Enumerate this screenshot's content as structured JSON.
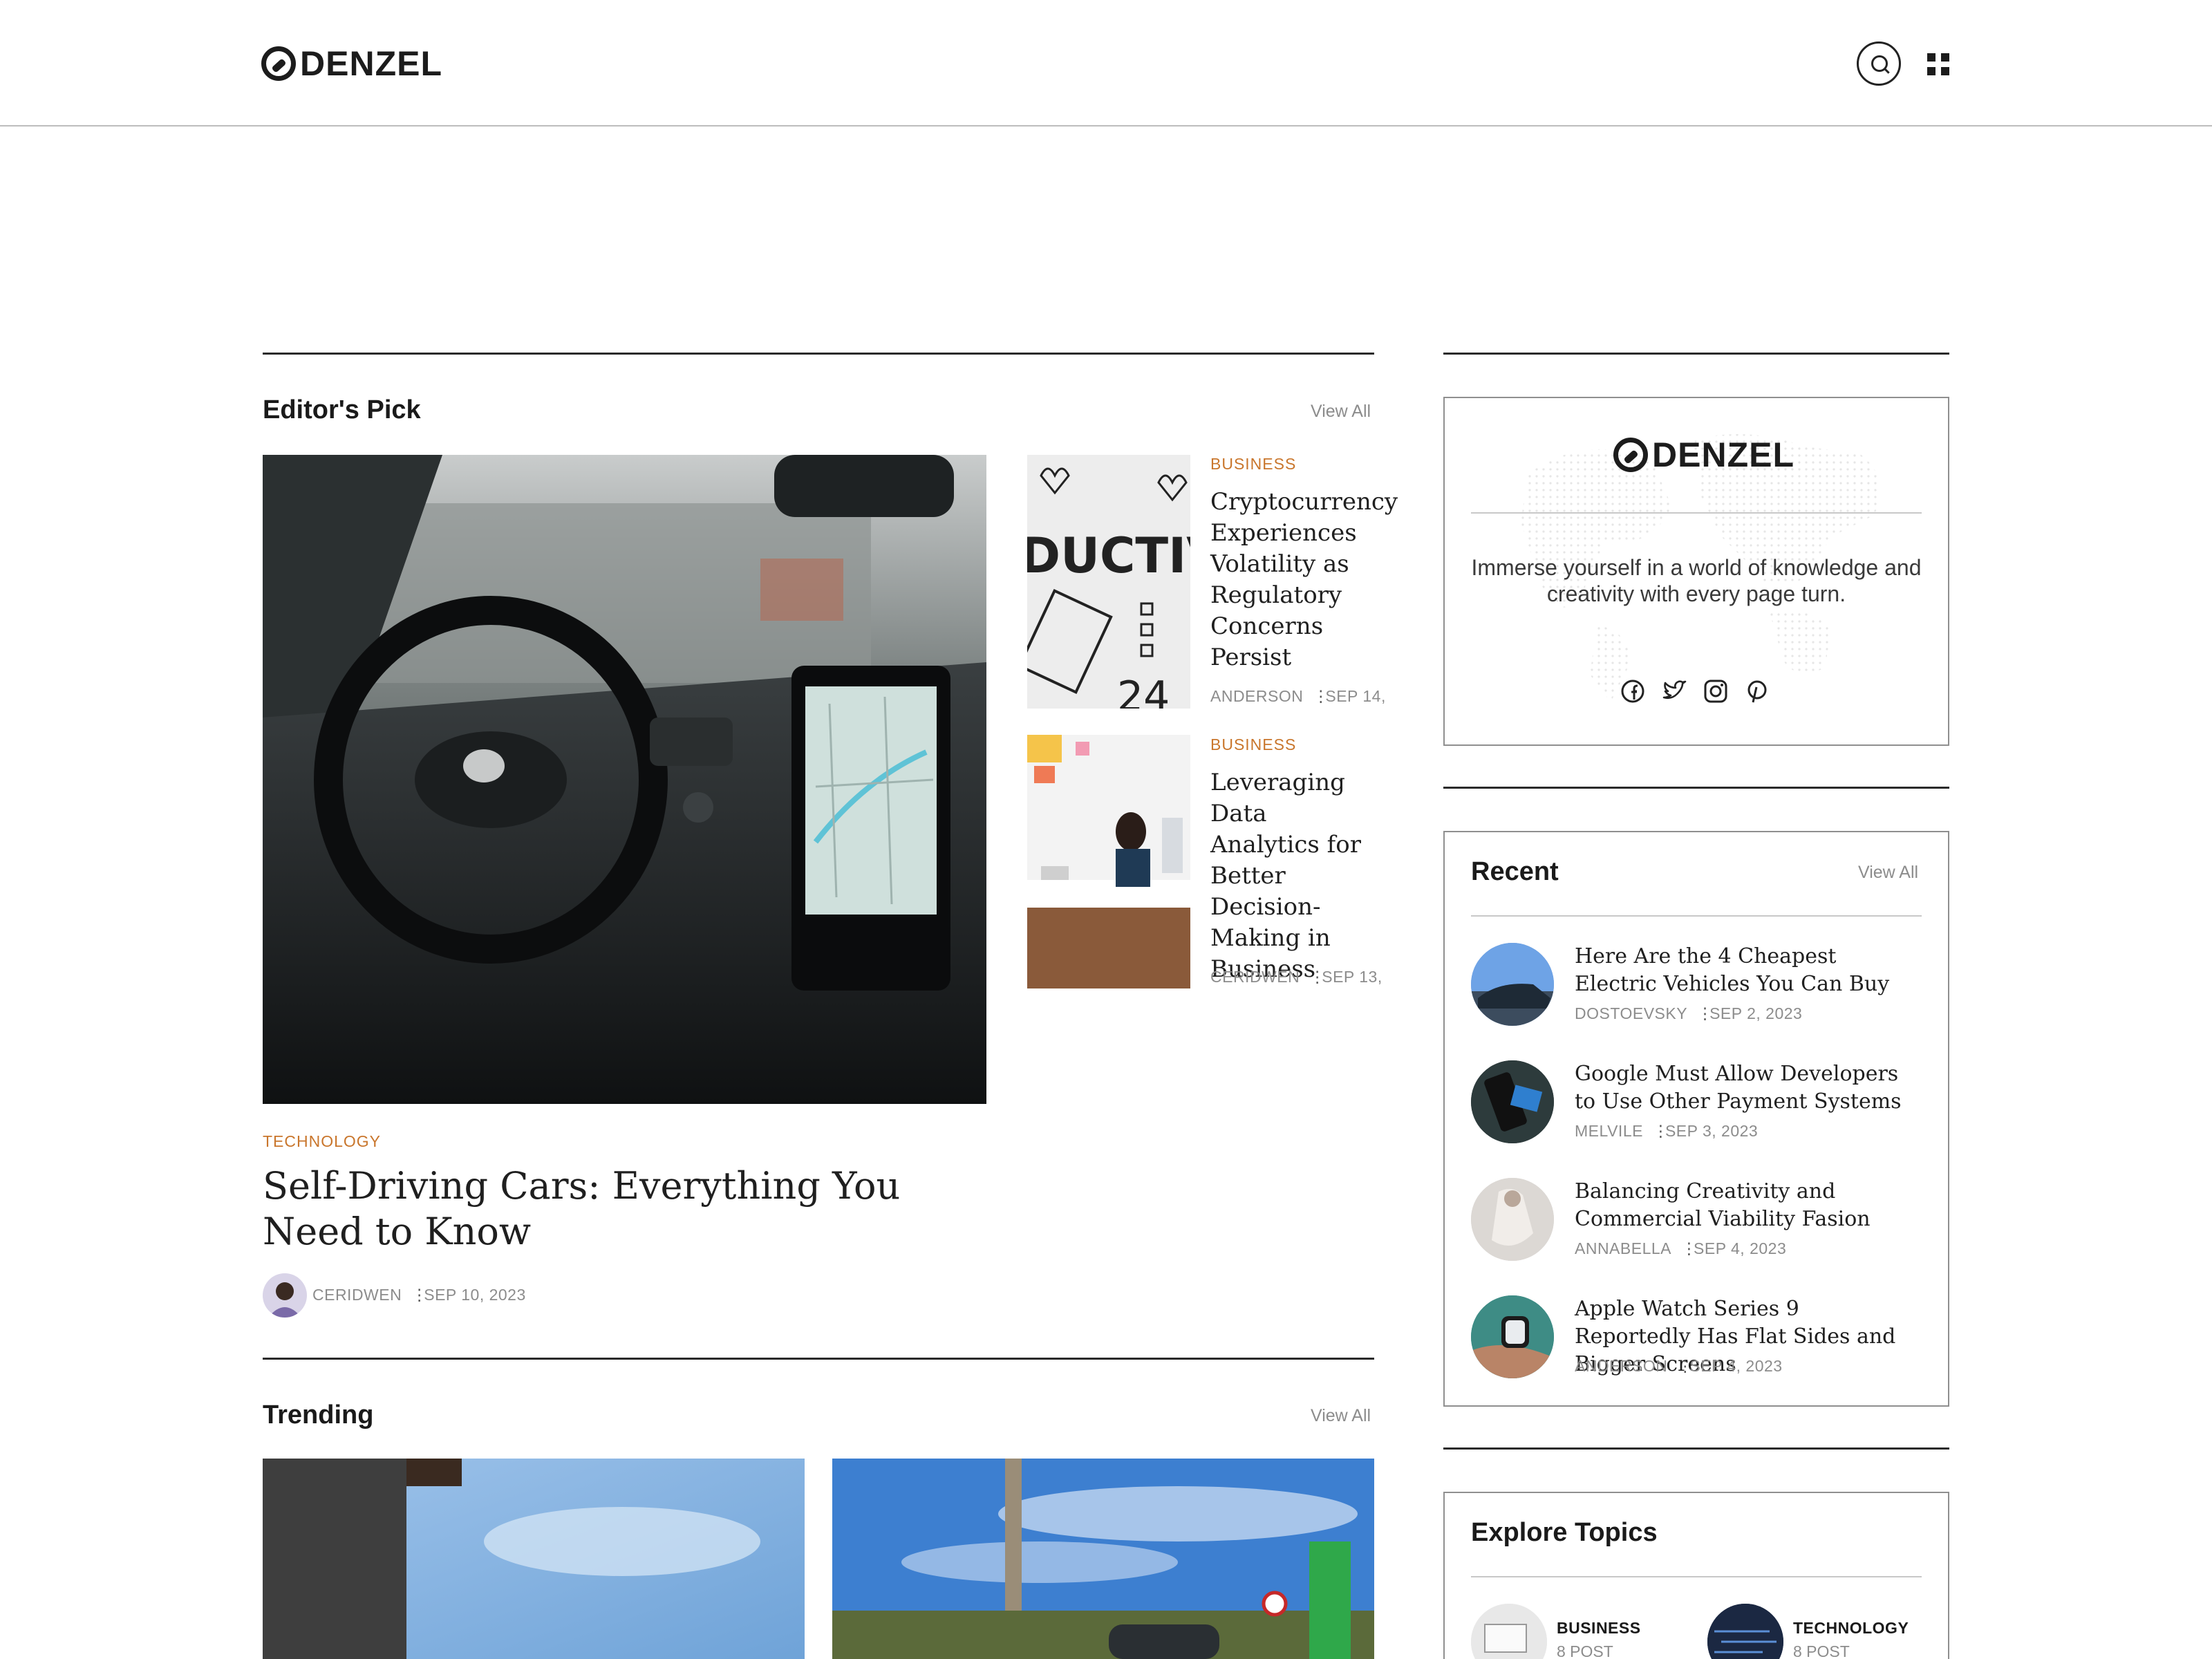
{
  "brand": {
    "name": "DENZEL"
  },
  "header": {
    "search_icon": "search-icon",
    "menu_icon": "grid-menu-icon"
  },
  "editors_pick": {
    "title": "Editor's Pick",
    "view_all": "View All",
    "featured": {
      "category": "TECHNOLOGY",
      "title": "Self-Driving Cars: Everything You Need to Know",
      "author": "CERIDWEN",
      "date": "SEP 10, 2023"
    },
    "side_posts": [
      {
        "category": "BUSINESS",
        "title": "Cryptocurrency Experiences Volatility as Regulatory Concerns Persist",
        "author": "ANDERSON",
        "date": "SEP 14,"
      },
      {
        "category": "BUSINESS",
        "title": "Leveraging Data Analytics for Better Decision-Making in Business",
        "author": "CERIDWEN",
        "date": "SEP 13,"
      }
    ]
  },
  "trending": {
    "title": "Trending",
    "view_all": "View All"
  },
  "about": {
    "text": "Immerse yourself in a world of knowledge and creativity with every page turn.",
    "socials": [
      "facebook-icon",
      "twitter-icon",
      "instagram-icon",
      "pinterest-icon"
    ]
  },
  "recent": {
    "title": "Recent",
    "view_all": "View All",
    "items": [
      {
        "title": "Here Are the 4 Cheapest Electric Vehicles You Can Buy",
        "author": "DOSTOEVSKY",
        "date": "SEP 2, 2023"
      },
      {
        "title": "Google Must Allow Developers to Use Other Payment Systems",
        "author": "MELVILE",
        "date": "SEP 3, 2023"
      },
      {
        "title": "Balancing Creativity and Commercial Viability Fasion",
        "author": "ANNABELLA",
        "date": "SEP 4, 2023"
      },
      {
        "title": "Apple Watch Series 9 Reportedly Has Flat Sides and Bigger Screens",
        "author": "ANDERSON",
        "date": "SEP 4, 2023"
      }
    ]
  },
  "topics": {
    "title": "Explore Topics",
    "items": [
      {
        "name": "BUSINESS",
        "count": "8 POST"
      },
      {
        "name": "TECHNOLOGY",
        "count": "8 POST"
      }
    ]
  }
}
